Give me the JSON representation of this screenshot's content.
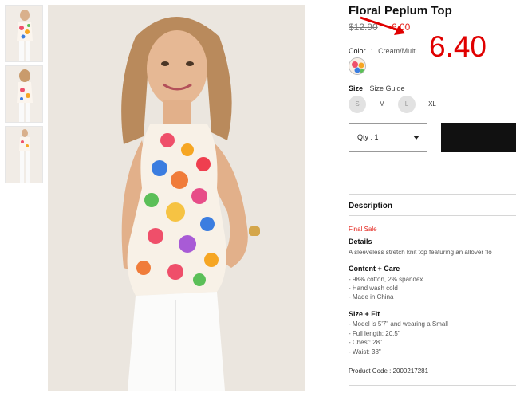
{
  "product": {
    "title": "Floral Peplum Top",
    "original_price": "$12.90",
    "sale_price": "6.00",
    "annotation": "6.40"
  },
  "color": {
    "label": "Color",
    "separator": ":",
    "value": "Cream/Multi"
  },
  "size": {
    "label": "Size",
    "guide_link": "Size Guide",
    "options": [
      {
        "label": "S",
        "available": false
      },
      {
        "label": "M",
        "available": true
      },
      {
        "label": "L",
        "available": false
      },
      {
        "label": "XL",
        "available": true
      }
    ]
  },
  "quantity": {
    "value": "Qty : 1"
  },
  "description": {
    "heading": "Description",
    "final_sale": "Final Sale",
    "details_heading": "Details",
    "details_text": "A sleeveless stretch knit top featuring an allover flo",
    "content_heading": "Content + Care",
    "content_lines": [
      "- 98% cotton, 2% spandex",
      "- Hand wash cold",
      "- Made in China"
    ],
    "fit_heading": "Size + Fit",
    "fit_lines": [
      "- Model is 5'7\" and wearing a Small",
      "- Full length: 20.5\"",
      "- Chest: 28\"",
      "- Waist: 38\""
    ],
    "product_code": "Product Code : 2000217281"
  },
  "colors": {
    "sale_red": "#e5231b",
    "annotation_red": "#e00000",
    "button_black": "#111111"
  }
}
